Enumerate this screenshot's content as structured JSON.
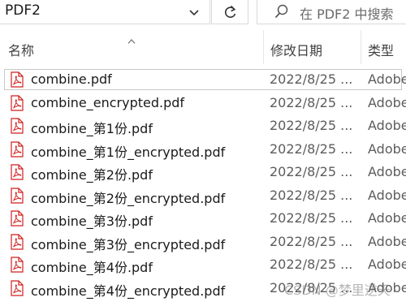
{
  "address_bar": {
    "path": "PDF2",
    "dropdown_icon": "chevron-down-icon",
    "refresh_icon": "refresh-icon"
  },
  "search": {
    "icon": "search-icon",
    "placeholder": "在 PDF2 中搜索"
  },
  "columns": [
    {
      "label": "名称"
    },
    {
      "label": "修改日期"
    },
    {
      "label": "类型"
    }
  ],
  "sort_indicator": "sort-up-icon",
  "files": [
    {
      "name": "combine.pdf",
      "date": "2022/8/25 ...",
      "type": "Adobe"
    },
    {
      "name": "combine_encrypted.pdf",
      "date": "2022/8/25 ...",
      "type": "Adobe"
    },
    {
      "name": "combine_第1份.pdf",
      "date": "2022/8/25 ...",
      "type": "Adobe"
    },
    {
      "name": "combine_第1份_encrypted.pdf",
      "date": "2022/8/25 ...",
      "type": "Adobe"
    },
    {
      "name": "combine_第2份.pdf",
      "date": "2022/8/25 ...",
      "type": "Adobe"
    },
    {
      "name": "combine_第2份_encrypted.pdf",
      "date": "2022/8/25 ...",
      "type": "Adobe"
    },
    {
      "name": "combine_第3份.pdf",
      "date": "2022/8/25 ...",
      "type": "Adobe"
    },
    {
      "name": "combine_第3份_encrypted.pdf",
      "date": "2022/8/25 ...",
      "type": "Adobe"
    },
    {
      "name": "combine_第4份.pdf",
      "date": "2022/8/25 ...",
      "type": "Adobe"
    },
    {
      "name": "combine_第4份_encrypted.pdf",
      "date": "2022/8/25 ...",
      "type": "Adobe"
    }
  ],
  "file_icon": "pdf-file-icon",
  "watermark": "CSDN @梦里逆天",
  "colors": {
    "pdf_red": "#d21f1f",
    "focus_border": "#c8c8c8"
  }
}
